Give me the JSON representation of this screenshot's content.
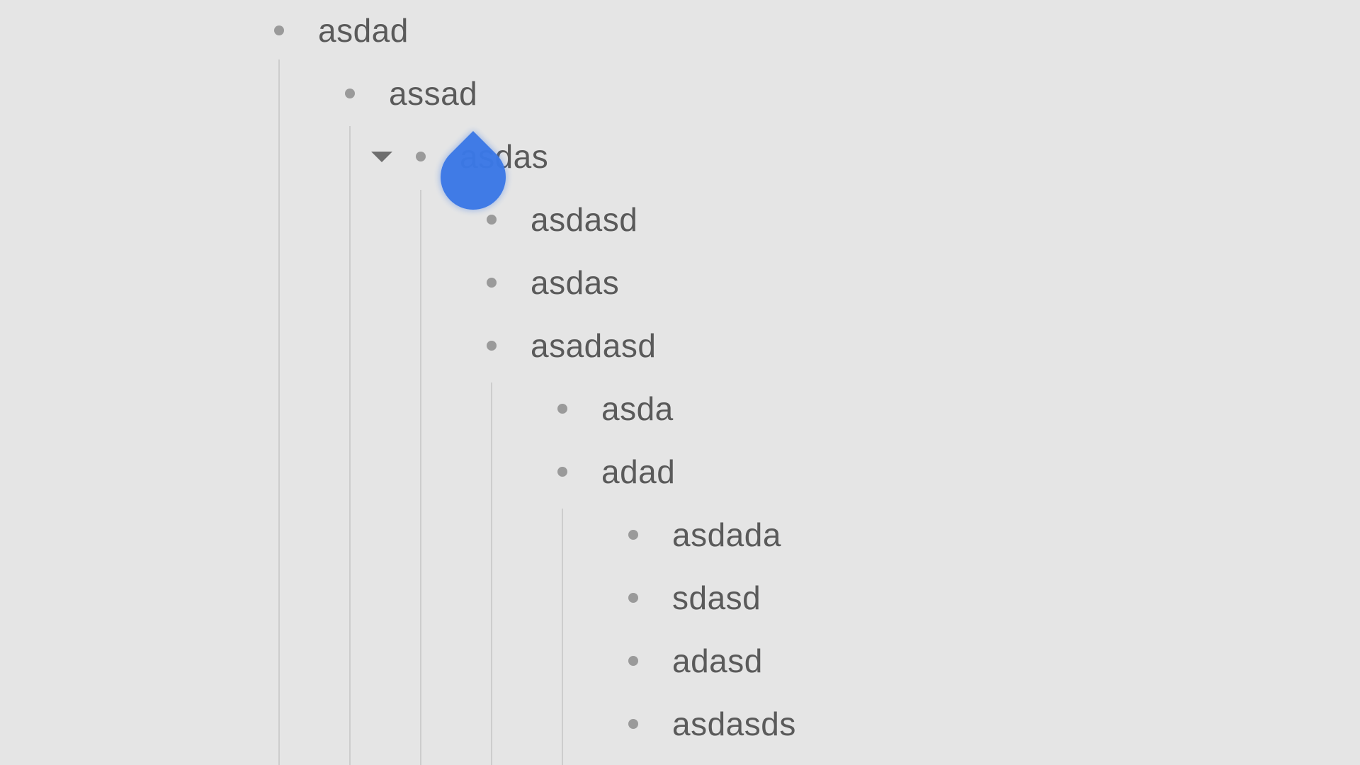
{
  "outline": {
    "items": [
      {
        "label": "asdad",
        "depth": 0
      },
      {
        "label": "assad",
        "depth": 1
      },
      {
        "label": "asdas",
        "depth": 2,
        "expanded": true
      },
      {
        "label": "asdasd",
        "depth": 3
      },
      {
        "label": "asdas",
        "depth": 3
      },
      {
        "label": "asadasd",
        "depth": 3
      },
      {
        "label": "asda",
        "depth": 4
      },
      {
        "label": "adad",
        "depth": 4
      },
      {
        "label": "asdada",
        "depth": 5
      },
      {
        "label": "sdasd",
        "depth": 5
      },
      {
        "label": "adasd",
        "depth": 5
      },
      {
        "label": "asdasds",
        "depth": 5
      }
    ]
  },
  "colors": {
    "background": "#e5e5e5",
    "text": "#5a5a5a",
    "bullet": "#9a9a9a",
    "guide": "#cdcdcd",
    "drag_handle": "#3b78e7"
  },
  "icons": {
    "collapse": "caret-down-icon",
    "bullet": "bullet-dot-icon",
    "drag": "drag-handle-icon"
  }
}
